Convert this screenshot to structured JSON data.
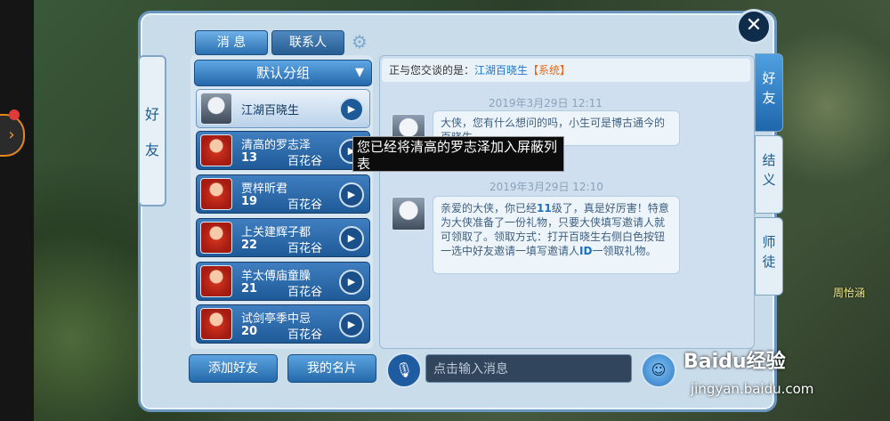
{
  "tabs": {
    "messages": "消 息",
    "contacts": "联系人"
  },
  "left_vertical_tab": "好 友",
  "group": {
    "label": "默认分组"
  },
  "contacts": [
    {
      "name": "江湖百晓生",
      "level": "",
      "school": "",
      "selected": true
    },
    {
      "name": "清高的罗志泽",
      "level": "13",
      "school": "百花谷"
    },
    {
      "name": "贾梓昕君",
      "level": "19",
      "school": "百花谷"
    },
    {
      "name": "上关建辉子都",
      "level": "22",
      "school": "百花谷"
    },
    {
      "name": "羊太傅庙童臊",
      "level": "21",
      "school": "百花谷"
    },
    {
      "name": "试剑亭季中忌",
      "level": "20",
      "school": "百花谷"
    }
  ],
  "tooltip": "您已经将清高的罗志泽加入屏蔽列表",
  "chat": {
    "header_prefix": "正与您交谈的是：",
    "header_name": "江湖百晓生",
    "header_tag": "【系统】",
    "messages": [
      {
        "time": "2019年3月29日 12:11",
        "text": "大侠，您有什么想问的吗，小生可是博古通今的百晓生。"
      },
      {
        "time": "2019年3月29日  12:10",
        "text_parts": [
          "亲爱的大侠，你已经",
          "11",
          "级了，真是好厉害！特意为大侠准备了一份礼物，只要大侠填写邀请人就可领取了。领取方式：打开百晓生右侧白色按钮一选中好友邀请一填写邀请人",
          "ID",
          "一领取礼物。"
        ]
      }
    ]
  },
  "buttons": {
    "add_friend": "添加好友",
    "my_card": "我的名片"
  },
  "input": {
    "placeholder": "点击输入消息"
  },
  "right_tabs": [
    {
      "label": "好\n友",
      "active": true
    },
    {
      "label": "结\n义",
      "active": false
    },
    {
      "label": "师\n徒",
      "active": false
    }
  ],
  "watermark": {
    "brand": "Baidu经验",
    "url": "jingyan.baidu.com"
  },
  "background": {
    "npc_name": "周怡涵"
  }
}
